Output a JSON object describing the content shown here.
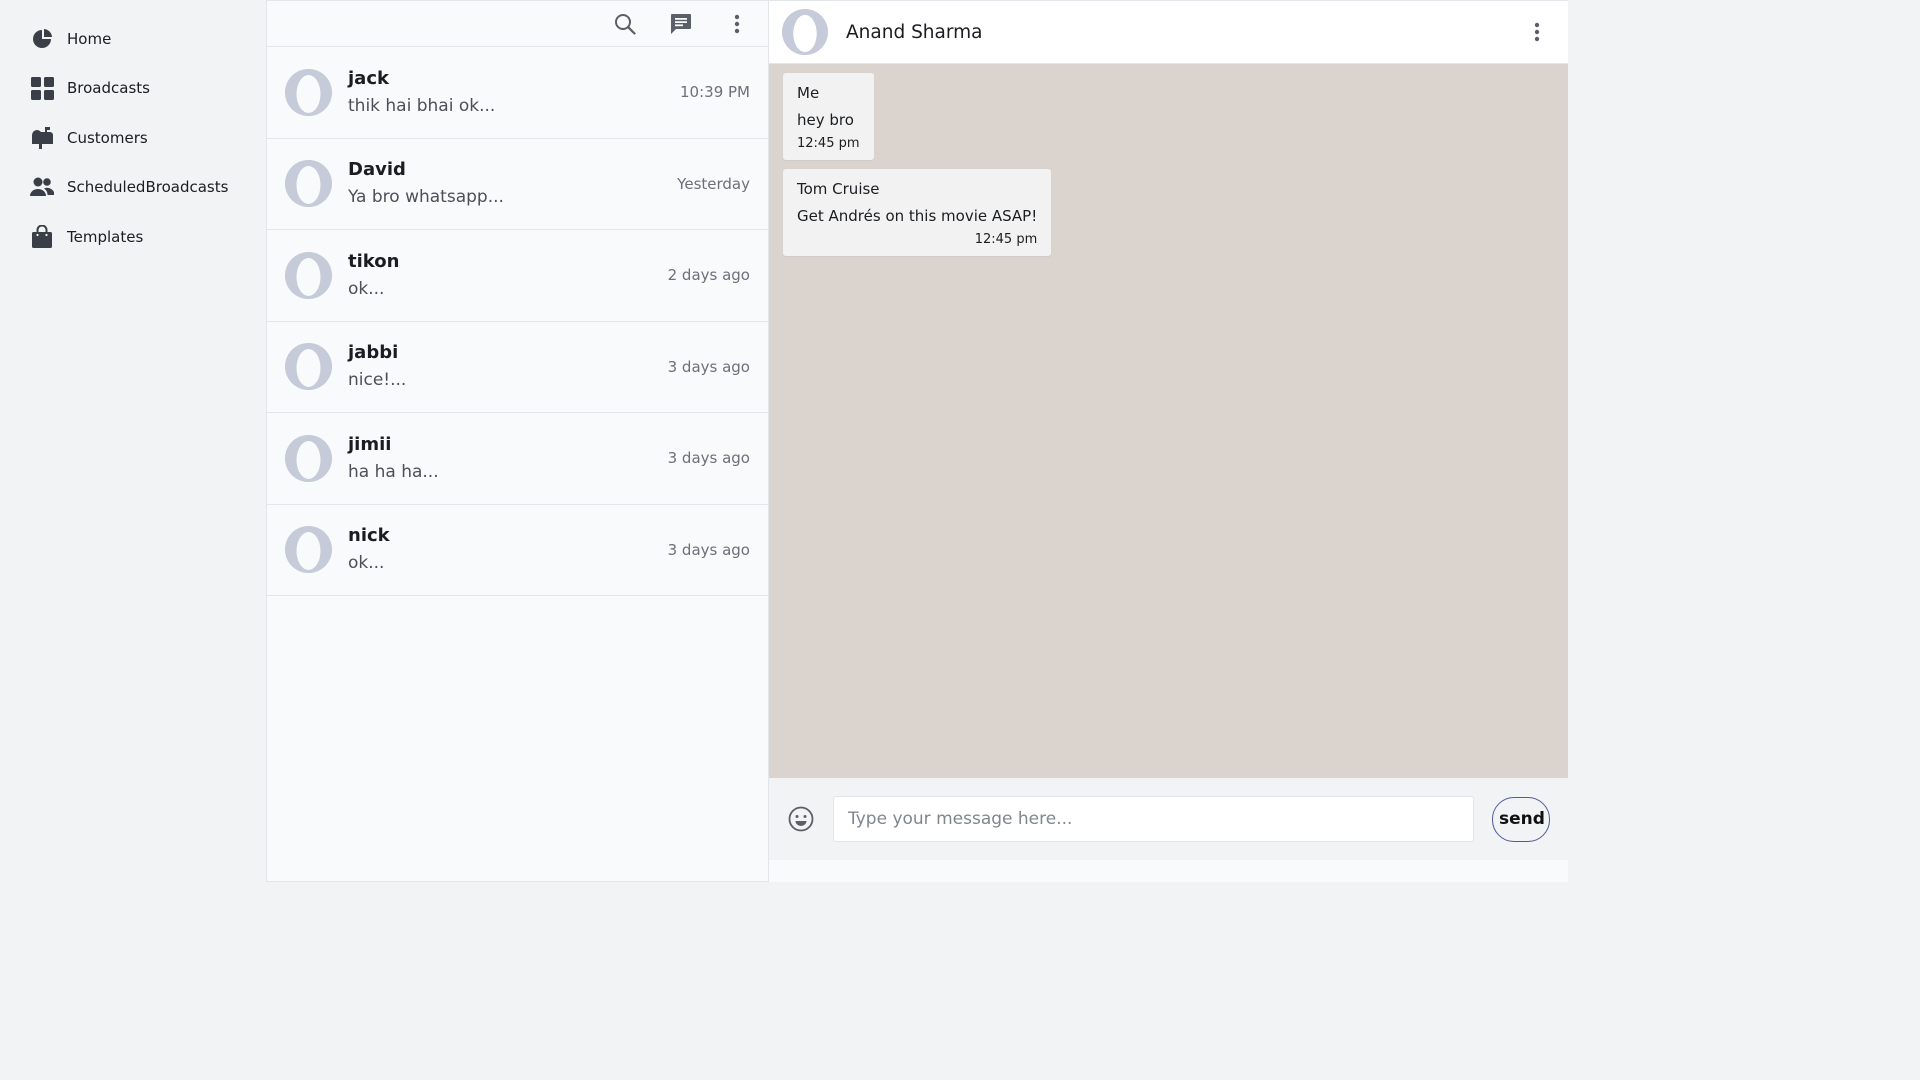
{
  "nav": {
    "items": [
      {
        "label": "Home",
        "icon": "pie-chart-icon"
      },
      {
        "label": "Broadcasts",
        "icon": "grid-icon"
      },
      {
        "label": "Customers",
        "icon": "mailbox-icon"
      },
      {
        "label": "ScheduledBroadcasts",
        "icon": "users-icon"
      },
      {
        "label": "Templates",
        "icon": "shopping-bag-icon"
      }
    ]
  },
  "chat_list": {
    "toolbar": [
      "search-icon",
      "new-chat-icon",
      "more-vertical-icon"
    ],
    "chats": [
      {
        "name": "jack",
        "preview": "thik hai bhai ok...",
        "time": "10:39 PM"
      },
      {
        "name": "David",
        "preview": "Ya bro whatsapp...",
        "time": "Yesterday"
      },
      {
        "name": "tikon",
        "preview": "ok...",
        "time": "2 days ago"
      },
      {
        "name": "jabbi",
        "preview": "nice!...",
        "time": "3 days ago"
      },
      {
        "name": "jimii",
        "preview": "ha ha ha...",
        "time": "3 days ago"
      },
      {
        "name": "nick",
        "preview": "ok...",
        "time": "3 days ago"
      }
    ]
  },
  "conversation": {
    "contact_name": "Anand Sharma",
    "messages": [
      {
        "sender": "Me",
        "text": "hey bro",
        "time": "12:45 pm"
      },
      {
        "sender": "Tom Cruise",
        "text": "Get Andrés on this movie ASAP!",
        "time": "12:45 pm"
      }
    ],
    "composer": {
      "placeholder": "Type your message here...",
      "send_label": "send"
    }
  },
  "colors": {
    "chat_background": "#dbd4ce",
    "send_border": "#4e5b9e",
    "avatar_placeholder": "#c5cbd8"
  }
}
